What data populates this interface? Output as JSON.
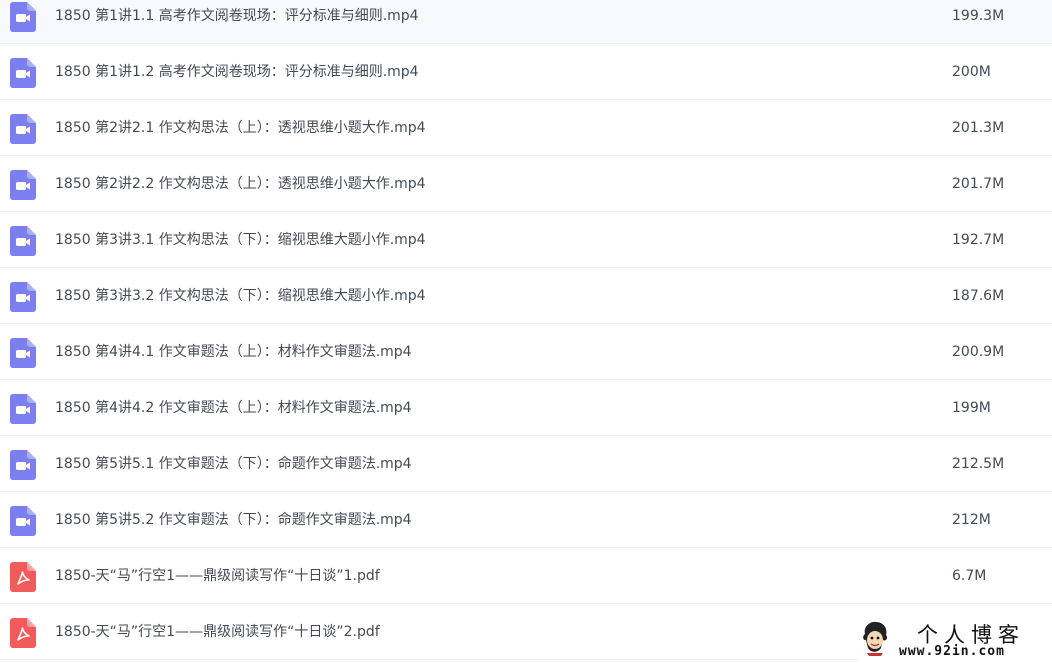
{
  "files": [
    {
      "name": "1850 第1讲1.1 高考作文阅卷现场：评分标准与细则.mp4",
      "size": "199.3M",
      "type": "video"
    },
    {
      "name": "1850 第1讲1.2 高考作文阅卷现场：评分标准与细则.mp4",
      "size": "200M",
      "type": "video"
    },
    {
      "name": "1850 第2讲2.1 作文构思法（上）：透视思维小题大作.mp4",
      "size": "201.3M",
      "type": "video"
    },
    {
      "name": "1850 第2讲2.2 作文构思法（上）：透视思维小题大作.mp4",
      "size": "201.7M",
      "type": "video"
    },
    {
      "name": "1850 第3讲3.1 作文构思法（下）：缩视思维大题小作.mp4",
      "size": "192.7M",
      "type": "video"
    },
    {
      "name": "1850 第3讲3.2 作文构思法（下）：缩视思维大题小作.mp4",
      "size": "187.6M",
      "type": "video"
    },
    {
      "name": "1850 第4讲4.1 作文审题法（上）：材料作文审题法.mp4",
      "size": "200.9M",
      "type": "video"
    },
    {
      "name": "1850 第4讲4.2 作文审题法（上）：材料作文审题法.mp4",
      "size": "199M",
      "type": "video"
    },
    {
      "name": "1850 第5讲5.1 作文审题法（下）：命题作文审题法.mp4",
      "size": "212.5M",
      "type": "video"
    },
    {
      "name": "1850 第5讲5.2 作文审题法（下）：命题作文审题法.mp4",
      "size": "212M",
      "type": "video"
    },
    {
      "name": "1850-天“马”行空1——鼎级阅读写作“十日谈”1.pdf",
      "size": "6.7M",
      "type": "pdf"
    },
    {
      "name": "1850-天“马”行空1——鼎级阅读写作“十日谈”2.pdf",
      "size": "",
      "type": "pdf"
    }
  ],
  "watermark": {
    "title": "个人博客",
    "url": "www.92in.com"
  },
  "colors": {
    "video_icon": "#7b7ff0",
    "pdf_icon": "#f25b5b",
    "text": "#444a55",
    "divider": "#eef0f4"
  },
  "icons": {
    "video": "video-file-icon",
    "pdf": "pdf-file-icon"
  }
}
